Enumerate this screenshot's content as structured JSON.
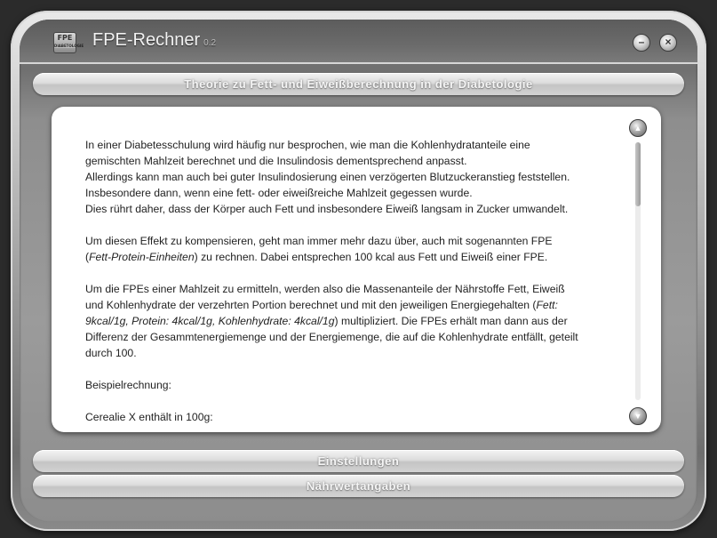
{
  "window": {
    "app_title": "FPE-Rechner",
    "app_version": "0.2",
    "logo_text": "FPE",
    "logo_subtext": "DIABETOLOGIE",
    "minimize_symbol": "–",
    "close_symbol": "×"
  },
  "sections": {
    "theory_label": "Theorie zu Fett- und Eiweißberechnung in der Diabetologie",
    "settings_label": "Einstellungen",
    "nutrition_label": "Nährwertangaben"
  },
  "content": {
    "p1": {
      "l1": "In einer Diabetesschulung wird häufig nur besprochen, wie man die Kohlenhydratanteile eine",
      "l2": "gemischten Mahlzeit berechnet und die Insulindosis dementsprechend anpasst.",
      "l3": "Allerdings kann man auch bei guter Insulindosierung einen verzögerten Blutzuckeranstieg feststellen.",
      "l4": "Insbesondere dann, wenn eine fett- oder eiweißreiche Mahlzeit gegessen wurde.",
      "l5": "Dies rührt daher, dass der Körper auch Fett und insbesondere Eiweiß langsam in Zucker umwandelt."
    },
    "p2": {
      "l1": "Um diesen Effekt zu kompensieren, geht man immer mehr dazu über, auch mit sogenannten FPE",
      "l2_open": "(",
      "l2_italic": "Fett-Protein-Einheiten",
      "l2_rest": ") zu rechnen. Dabei entsprechen 100 kcal aus Fett und Eiweiß einer FPE."
    },
    "p3": {
      "l1": "Um die FPEs einer Mahlzeit zu ermitteln, werden also die Massenanteile der Nährstoffe Fett, Eiweiß",
      "l2_start": "und Kohlenhydrate der verzehrten Portion berechnet und mit den jeweiligen Energiegehalten (",
      "l2_italic": "Fett:",
      "l3_italic": "9kcal/1g, Protein: 4kcal/1g, Kohlenhydrate: 4kcal/1g",
      "l3_rest": ") multipliziert. Die FPEs erhält man dann aus der",
      "l4": "Differenz der Gesammtenergiemenge und der Energiemenge, die auf die Kohlenhydrate entfällt, geteilt",
      "l5": "durch 100."
    },
    "p4": "Beispielrechnung:",
    "p5": "Cerealie X enthält in 100g:"
  },
  "scrollbar": {
    "up_symbol": "▲",
    "down_symbol": "▼",
    "position_fraction": 0.0
  }
}
